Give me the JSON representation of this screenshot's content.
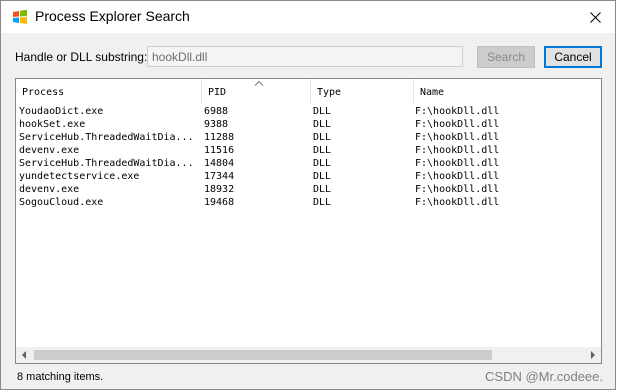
{
  "window": {
    "title": "Process Explorer Search"
  },
  "search": {
    "label": "Handle or DLL substring:",
    "value": "hookDll.dll"
  },
  "buttons": {
    "search": "Search",
    "cancel": "Cancel"
  },
  "results": {
    "columns": [
      "Process",
      "PID",
      "Type",
      "Name"
    ],
    "rows": [
      [
        "YoudaoDict.exe",
        "6988",
        "DLL",
        "F:\\hookDll.dll"
      ],
      [
        "hookSet.exe",
        "9388",
        "DLL",
        "F:\\hookDll.dll"
      ],
      [
        "ServiceHub.ThreadedWaitDia...",
        "11288",
        "DLL",
        "F:\\hookDll.dll"
      ],
      [
        "devenv.exe",
        "11516",
        "DLL",
        "F:\\hookDll.dll"
      ],
      [
        "ServiceHub.ThreadedWaitDia...",
        "14804",
        "DLL",
        "F:\\hookDll.dll"
      ],
      [
        "yundetectservice.exe",
        "17344",
        "DLL",
        "F:\\hookDll.dll"
      ],
      [
        "devenv.exe",
        "18932",
        "DLL",
        "F:\\hookDll.dll"
      ],
      [
        "SogouCloud.exe",
        "19468",
        "DLL",
        "F:\\hookDll.dll"
      ]
    ],
    "sort_icon": "sort-up-icon"
  },
  "status": {
    "text": "8 matching items."
  },
  "watermark": {
    "text": "CSDN @Mr.codeee."
  },
  "colors": {
    "accent": "#0078d7",
    "dialog_bg": "#f0f0f0"
  }
}
